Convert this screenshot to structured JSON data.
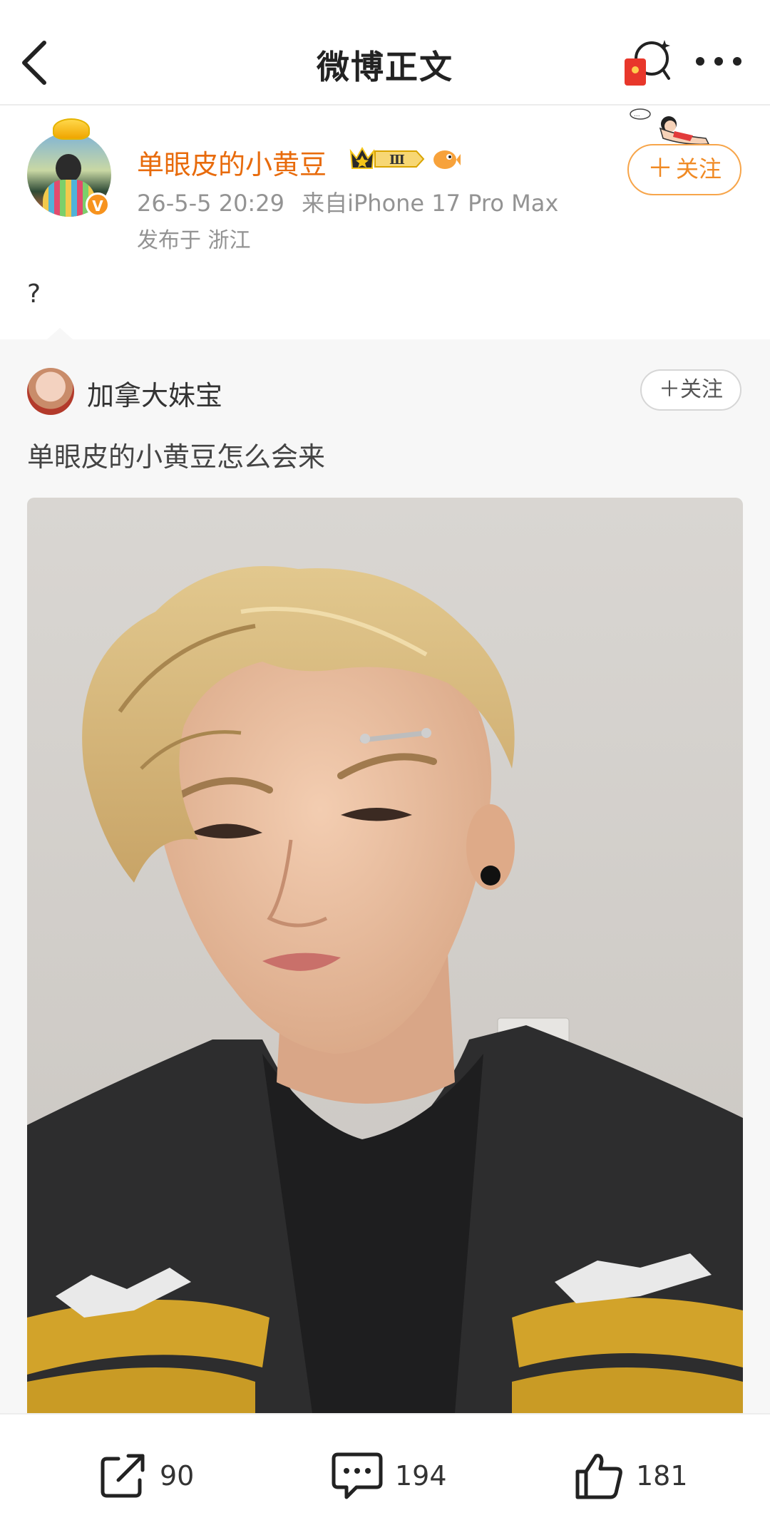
{
  "nav": {
    "title": "微博正文",
    "back_icon": "chevron-left-icon",
    "redpack_icon": "red-envelope-icon",
    "more_icon": "more-dots-icon"
  },
  "author": {
    "name": "单眼皮的小黄豆",
    "level_badge": "Ⅲ",
    "timestamp": "26-5-5 20:29",
    "source": "来自iPhone 17 Pro Max",
    "location": "发布于 浙江",
    "verified": "V",
    "follow_label": "关注",
    "follow_plus": "＋",
    "name_color": "#e86b0c"
  },
  "post": {
    "text": "?"
  },
  "repost": {
    "user": "加拿大妹宝",
    "follow_label": "关注",
    "follow_plus": "＋",
    "text": "单眼皮的小黄豆怎么会来"
  },
  "bottom_bar": {
    "share_count": "90",
    "comment_count": "194",
    "like_count": "181"
  },
  "colors": {
    "accent_orange": "#f08a24",
    "background": "#ffffff",
    "repost_bg": "#f7f7f7"
  }
}
